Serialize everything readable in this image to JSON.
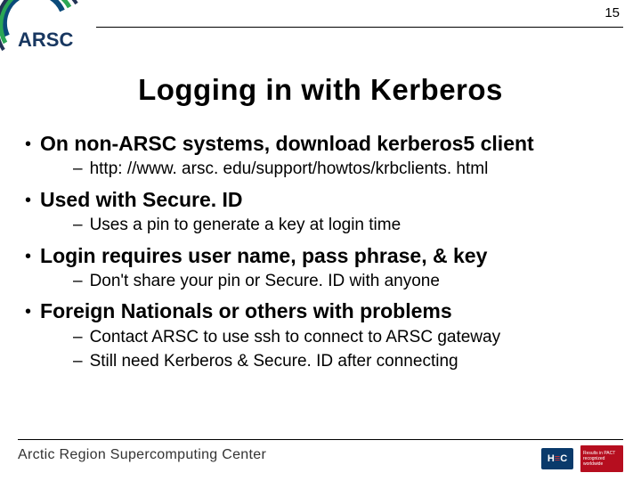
{
  "page_number": "15",
  "logo_text": "ARSC",
  "title": "Logging in with Kerberos",
  "bullets": [
    {
      "main": "On non-ARSC systems, download kerberos5 client",
      "subs": [
        "http: //www. arsc. edu/support/howtos/krbclients. html"
      ]
    },
    {
      "main": "Used with Secure. ID",
      "subs": [
        "Uses a pin to generate a key at login time"
      ]
    },
    {
      "main": "Login requires user name, pass phrase, & key",
      "subs": [
        "Don't share your pin or Secure. ID with anyone"
      ]
    },
    {
      "main": "Foreign Nationals or others with problems",
      "subs": [
        "Contact ARSC to use ssh to connect to ARSC gateway",
        "Still need Kerberos & Secure. ID after connecting"
      ]
    }
  ],
  "footer_text": "Arctic Region Supercomputing Center",
  "hpc_label": "H C",
  "red_badge_lines": [
    "Results in PACT",
    "recognized",
    "worldwide"
  ]
}
